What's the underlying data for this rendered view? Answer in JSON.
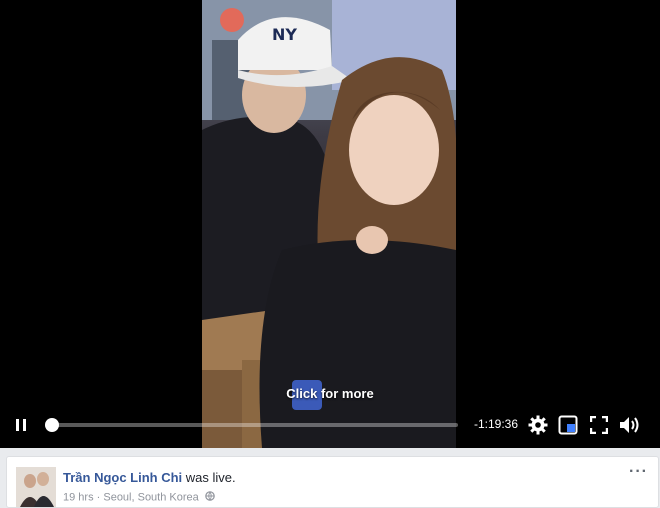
{
  "player": {
    "overlay_text": "Click for more",
    "time_remaining": "-1:19:36",
    "playback_state": "playing",
    "progress_fraction": 0.01,
    "controls": {
      "pause_icon": "pause-icon",
      "settings_icon": "gear-icon",
      "pip_icon": "picture-in-picture-icon",
      "fullscreen_icon": "fullscreen-icon",
      "volume_icon": "volume-icon"
    },
    "accent_color": "#4080ff"
  },
  "post": {
    "author": "Trần Ngọc Linh Chi",
    "action": " was live.",
    "time": "19 hrs",
    "separator": " · ",
    "location": "Seoul, South Korea",
    "more_label": "···",
    "privacy_icon": "globe-icon"
  }
}
